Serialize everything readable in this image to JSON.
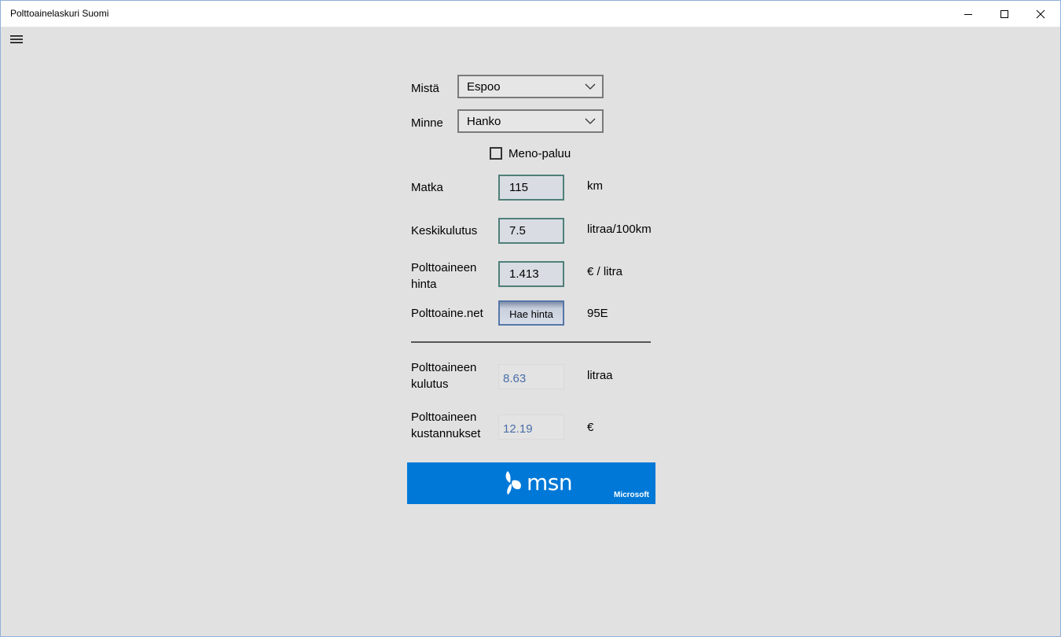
{
  "window": {
    "title": "Polttoainelaskuri Suomi"
  },
  "form": {
    "from_label": "Mistä",
    "from_value": "Espoo",
    "to_label": "Minne",
    "to_value": "Hanko",
    "round_trip_label": "Meno-paluu",
    "round_trip_checked": false,
    "distance_label": "Matka",
    "distance_value": "115",
    "distance_unit": "km",
    "consumption_label": "Keskikulutus",
    "consumption_value": "7.5",
    "consumption_unit": "litraa/100km",
    "price_label_line1": "Polttoaineen",
    "price_label_line2": "hinta",
    "price_value": "1.413",
    "price_unit": "€ / litra",
    "source_label": "Polttoaine.net",
    "fetch_button": "Hae hinta",
    "fuel_type": "95E"
  },
  "results": {
    "usage_label_line1": "Polttoaineen",
    "usage_label_line2": "kulutus",
    "usage_value": "8.63",
    "usage_unit": "litraa",
    "cost_label_line1": "Polttoaineen",
    "cost_label_line2": "kustannukset",
    "cost_value": "12.19",
    "cost_unit": "€"
  },
  "ad": {
    "brand": "msn",
    "company": "Microsoft",
    "color": "#0078d7"
  },
  "icons": {
    "menu": "hamburger-icon",
    "minimize": "minimize-icon",
    "maximize": "maximize-icon",
    "close": "close-icon",
    "dropdown": "chevron-down-icon",
    "msn": "msn-butterfly-icon"
  }
}
